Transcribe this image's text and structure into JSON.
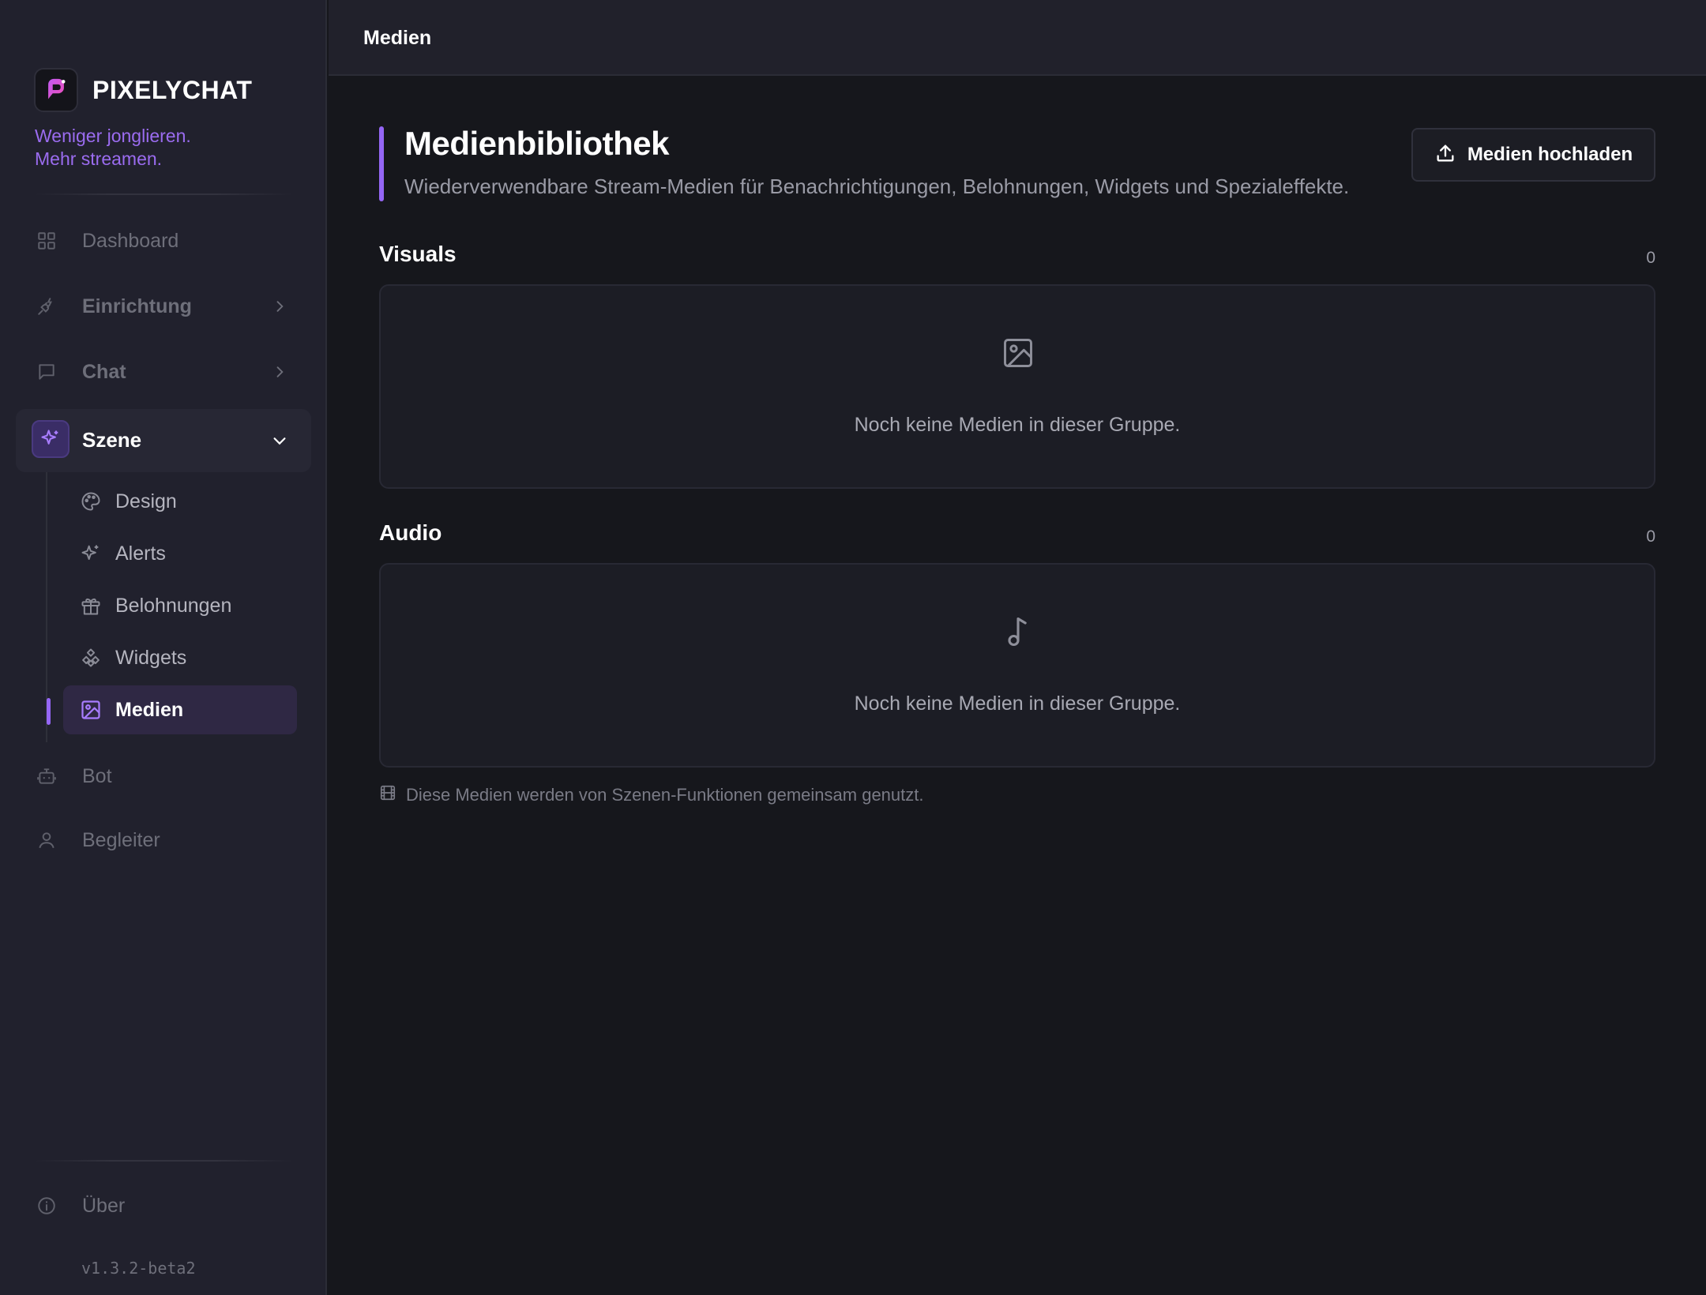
{
  "brand": {
    "name": "PIXELYCHAT",
    "tagline_line1": "Weniger jonglieren.",
    "tagline_line2": "Mehr streamen."
  },
  "sidebar": {
    "items": [
      {
        "label": "Dashboard",
        "icon": "grid-icon"
      },
      {
        "label": "Einrichtung",
        "icon": "plug-icon"
      },
      {
        "label": "Chat",
        "icon": "message-icon"
      },
      {
        "label": "Szene",
        "icon": "sparkles-icon"
      },
      {
        "label": "Bot",
        "icon": "bot-icon"
      },
      {
        "label": "Begleiter",
        "icon": "user-icon"
      }
    ],
    "subitems": [
      {
        "label": "Design",
        "icon": "palette-icon"
      },
      {
        "label": "Alerts",
        "icon": "sparkles-icon"
      },
      {
        "label": "Belohnungen",
        "icon": "gift-icon"
      },
      {
        "label": "Widgets",
        "icon": "shapes-icon"
      },
      {
        "label": "Medien",
        "icon": "image-icon",
        "active": true
      }
    ],
    "about": {
      "label": "Über",
      "icon": "info-icon"
    },
    "version": "v1.3.2-beta2"
  },
  "topbar": {
    "title": "Medien"
  },
  "page": {
    "title": "Medienbibliothek",
    "subtitle": "Wiederverwendbare Stream-Medien für Benachrichtigungen, Belohnungen, Widgets und Spezialeffekte.",
    "upload_label": "Medien hochladen"
  },
  "sections": [
    {
      "title": "Visuals",
      "count": "0",
      "empty": "Noch keine Medien in dieser Gruppe.",
      "icon": "image-icon"
    },
    {
      "title": "Audio",
      "count": "0",
      "empty": "Noch keine Medien in dieser Gruppe.",
      "icon": "music-note-icon"
    }
  ],
  "footnote": {
    "text": "Diese Medien werden von Szenen-Funktionen gemeinsam genutzt.",
    "icon": "film-icon"
  },
  "colors": {
    "accent": "#9566f5",
    "tagline": "#9b6cf0",
    "background": "#16171c",
    "sidebar": "#21212d"
  }
}
